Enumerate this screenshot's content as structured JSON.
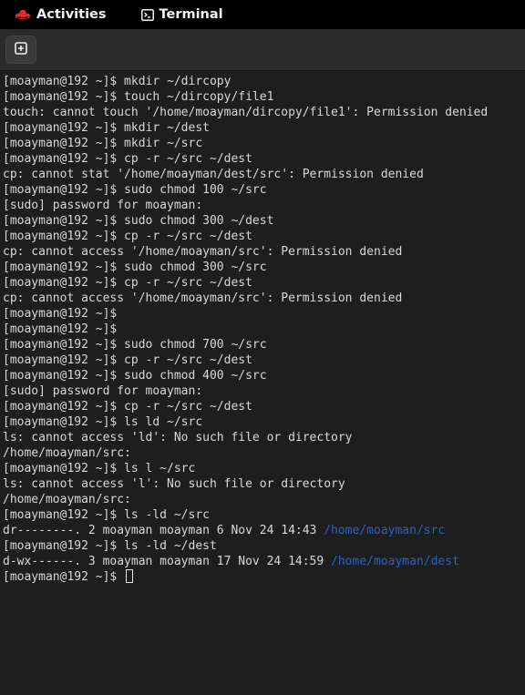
{
  "topbar": {
    "activities_label": "Activities",
    "app_label": "Terminal",
    "fedora_icon": "fedora-logo-icon",
    "terminal_icon": "terminal-icon",
    "accent_color": "#e0292f"
  },
  "headerbar": {
    "new_tab_icon": "new-tab-icon"
  },
  "terminal": {
    "lines": [
      {
        "text": "[moayman@192 ~]$ mkdir ~/dircopy"
      },
      {
        "text": "[moayman@192 ~]$ touch ~/dircopy/file1"
      },
      {
        "text": "touch: cannot touch '/home/moayman/dircopy/file1': Permission denied"
      },
      {
        "text": "[moayman@192 ~]$ mkdir ~/dest"
      },
      {
        "text": "[moayman@192 ~]$ mkdir ~/src"
      },
      {
        "text": "[moayman@192 ~]$ cp -r ~/src ~/dest"
      },
      {
        "text": "cp: cannot stat '/home/moayman/dest/src': Permission denied"
      },
      {
        "text": "[moayman@192 ~]$ sudo chmod 100 ~/src"
      },
      {
        "text": "[sudo] password for moayman:"
      },
      {
        "text": "[moayman@192 ~]$ sudo chmod 300 ~/dest"
      },
      {
        "text": "[moayman@192 ~]$ cp -r ~/src ~/dest"
      },
      {
        "text": "cp: cannot access '/home/moayman/src': Permission denied"
      },
      {
        "text": "[moayman@192 ~]$ sudo chmod 300 ~/src"
      },
      {
        "text": "[moayman@192 ~]$ cp -r ~/src ~/dest"
      },
      {
        "text": "cp: cannot access '/home/moayman/src': Permission denied"
      },
      {
        "text": "[moayman@192 ~]$"
      },
      {
        "text": "[moayman@192 ~]$"
      },
      {
        "text": "[moayman@192 ~]$ sudo chmod 700 ~/src"
      },
      {
        "text": "[moayman@192 ~]$ cp -r ~/src ~/dest"
      },
      {
        "text": "[moayman@192 ~]$ sudo chmod 400 ~/src"
      },
      {
        "text": "[sudo] password for moayman:"
      },
      {
        "text": "[moayman@192 ~]$ cp -r ~/src ~/dest"
      },
      {
        "text": "[moayman@192 ~]$ ls ld ~/src"
      },
      {
        "text": "ls: cannot access 'ld': No such file or directory"
      },
      {
        "text": "/home/moayman/src:"
      },
      {
        "text": "[moayman@192 ~]$ ls l ~/src"
      },
      {
        "text": "ls: cannot access 'l': No such file or directory"
      },
      {
        "text": "/home/moayman/src:"
      },
      {
        "text": "[moayman@192 ~]$ ls -ld ~/src"
      },
      {
        "text": "dr--------. 2 moayman moayman 6 Nov 24 14:43 ",
        "dir": "/home/moayman/src"
      },
      {
        "text": "[moayman@192 ~]$ ls -ld ~/dest"
      },
      {
        "text": "d-wx------. 3 moayman moayman 17 Nov 24 14:59 ",
        "dir": "/home/moayman/dest"
      }
    ],
    "prompt": "[moayman@192 ~]$ ",
    "directory_color": "#2a62c9"
  }
}
